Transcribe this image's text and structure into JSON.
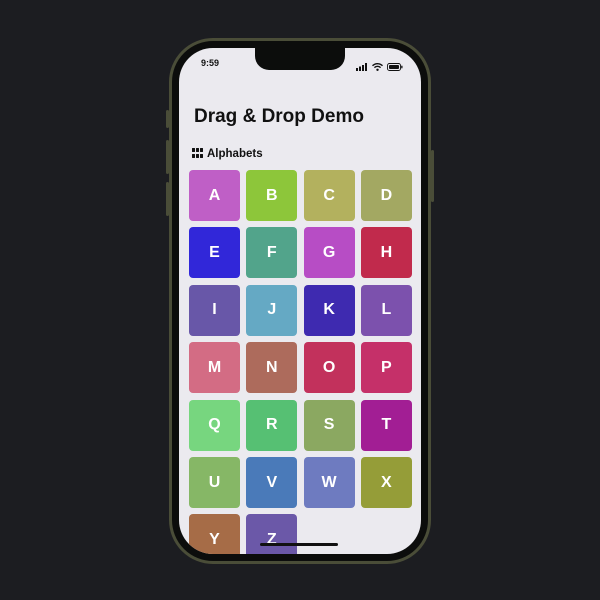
{
  "status_bar": {
    "time": "9:59"
  },
  "header": {
    "title": "Drag & Drop Demo"
  },
  "section": {
    "label": "Alphabets",
    "icon": "grid-icon"
  },
  "tiles": [
    {
      "letter": "A",
      "color": "#bf5fc6"
    },
    {
      "letter": "B",
      "color": "#8dc63a"
    },
    {
      "letter": "C",
      "color": "#b3b15e"
    },
    {
      "letter": "D",
      "color": "#a3a862"
    },
    {
      "letter": "E",
      "color": "#3127d9"
    },
    {
      "letter": "F",
      "color": "#52a48b"
    },
    {
      "letter": "G",
      "color": "#b74dc5"
    },
    {
      "letter": "H",
      "color": "#c12a4c"
    },
    {
      "letter": "I",
      "color": "#6857a8"
    },
    {
      "letter": "J",
      "color": "#65a9c4"
    },
    {
      "letter": "K",
      "color": "#3e2ab0"
    },
    {
      "letter": "L",
      "color": "#7c51ad"
    },
    {
      "letter": "M",
      "color": "#d36c84"
    },
    {
      "letter": "N",
      "color": "#ad6b5c"
    },
    {
      "letter": "O",
      "color": "#c2315c"
    },
    {
      "letter": "P",
      "color": "#c53069"
    },
    {
      "letter": "Q",
      "color": "#77d67f"
    },
    {
      "letter": "R",
      "color": "#56c073"
    },
    {
      "letter": "S",
      "color": "#8ba861"
    },
    {
      "letter": "T",
      "color": "#a21e94"
    },
    {
      "letter": "U",
      "color": "#86b766"
    },
    {
      "letter": "V",
      "color": "#4a7ab9"
    },
    {
      "letter": "W",
      "color": "#6e7bc0"
    },
    {
      "letter": "X",
      "color": "#959d38"
    },
    {
      "letter": "Y",
      "color": "#a66c47"
    },
    {
      "letter": "Z",
      "color": "#6b58a8"
    }
  ]
}
